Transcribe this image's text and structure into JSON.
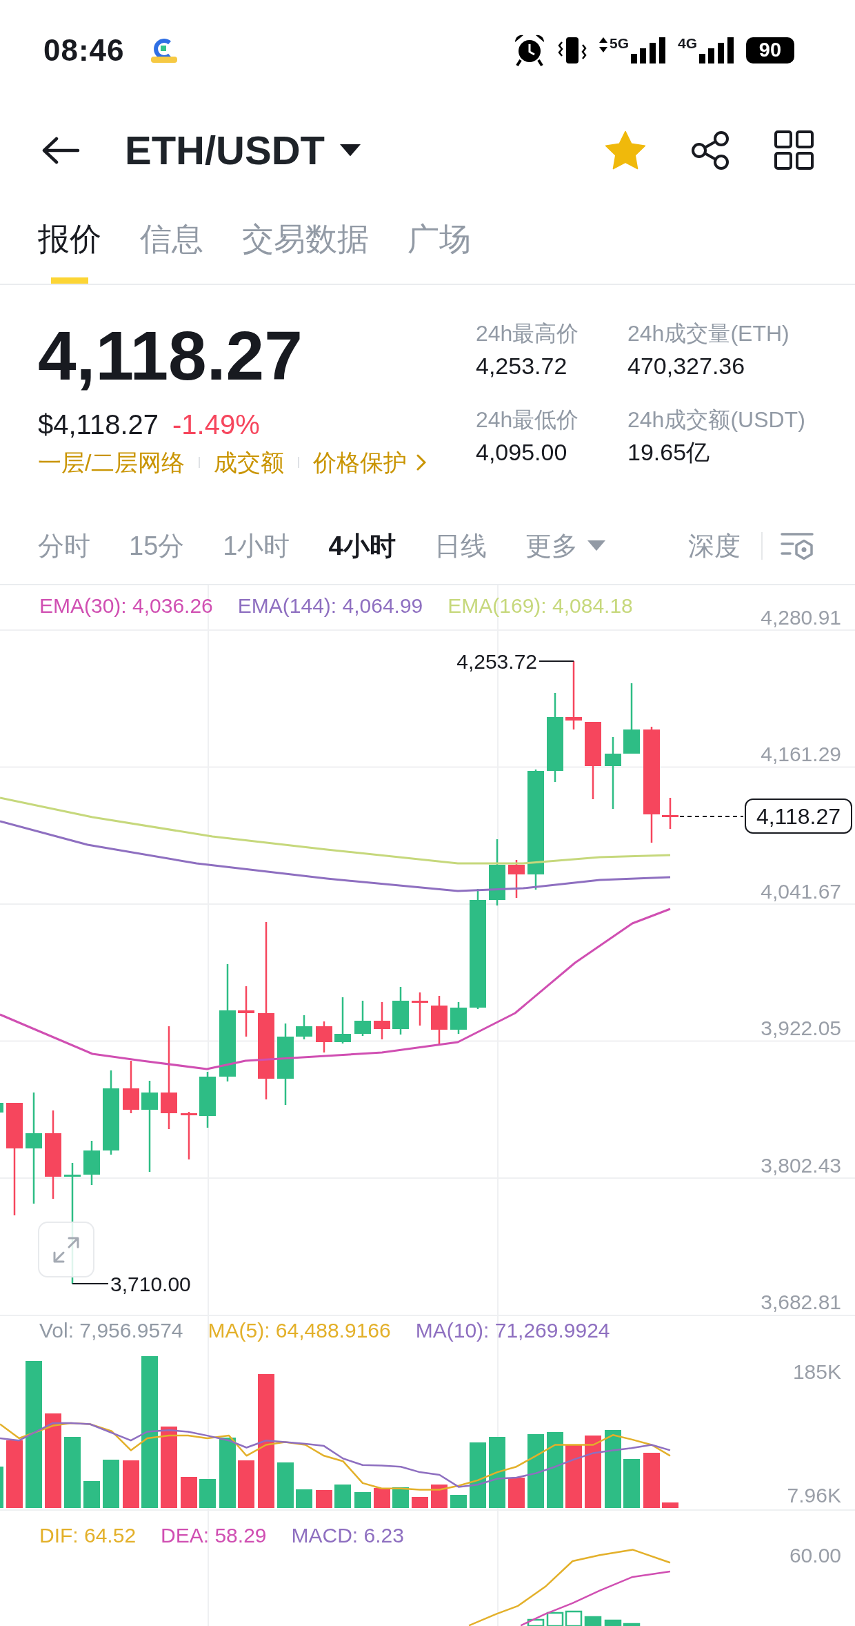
{
  "status_bar": {
    "time": "08:46",
    "network_1": "5G",
    "network_2": "4G",
    "battery": "90"
  },
  "header": {
    "pair": "ETH/USDT",
    "favorite": true
  },
  "tabs": [
    {
      "label": "报价",
      "selected": true
    },
    {
      "label": "信息",
      "selected": false
    },
    {
      "label": "交易数据",
      "selected": false
    },
    {
      "label": "广场",
      "selected": false
    }
  ],
  "price": {
    "last": "4,118.27",
    "fiat": "$4,118.27",
    "change": "-1.49%",
    "falling": true,
    "links": [
      "一层/二层网络",
      "成交额",
      "价格保护"
    ]
  },
  "stats": [
    {
      "label": "24h最高价",
      "value": "4,253.72"
    },
    {
      "label": "24h成交量(ETH)",
      "value": "470,327.36"
    },
    {
      "label": "24h最低价",
      "value": "4,095.00"
    },
    {
      "label": "24h成交额(USDT)",
      "value": "19.65亿"
    }
  ],
  "intervals": [
    {
      "label": "分时",
      "selected": false,
      "kind": "option"
    },
    {
      "label": "15分",
      "selected": false,
      "kind": "option"
    },
    {
      "label": "1小时",
      "selected": false,
      "kind": "option"
    },
    {
      "label": "4小时",
      "selected": true,
      "kind": "option"
    },
    {
      "label": "日线",
      "selected": false,
      "kind": "option"
    },
    {
      "label": "更多",
      "selected": false,
      "kind": "dropdown"
    }
  ],
  "depth": "深度",
  "chart": {
    "legend": [
      {
        "label": "EMA(30): 4,036.26",
        "color": "#d04fb2"
      },
      {
        "label": "EMA(144): 4,064.99",
        "color": "#8e6fc0"
      },
      {
        "label": "EMA(169): 4,084.18",
        "color": "#c6d87c"
      }
    ],
    "axis": [
      "4,280.91",
      "4,161.29",
      "4,041.67",
      "3,922.05",
      "3,802.43",
      "3,682.81"
    ],
    "high_label": "4,253.72",
    "low_label": "3,710.00",
    "last_price": "4,118.27"
  },
  "volume": {
    "legend": [
      {
        "label": "Vol: 7,956.9574",
        "color": "#929aa5"
      },
      {
        "label": "MA(5): 64,488.9166",
        "color": "#e3b02a"
      },
      {
        "label": "MA(10): 71,269.9924",
        "color": "#8e6fc0"
      }
    ],
    "axis": [
      "185K",
      "7.96K"
    ]
  },
  "macd": {
    "legend": [
      {
        "label": "DIF: 64.52",
        "color": "#e3b02a"
      },
      {
        "label": "DEA: 58.29",
        "color": "#d04fb2"
      },
      {
        "label": "MACD: 6.23",
        "color": "#8e6fc0"
      }
    ],
    "axis": [
      "60.00"
    ]
  }
}
